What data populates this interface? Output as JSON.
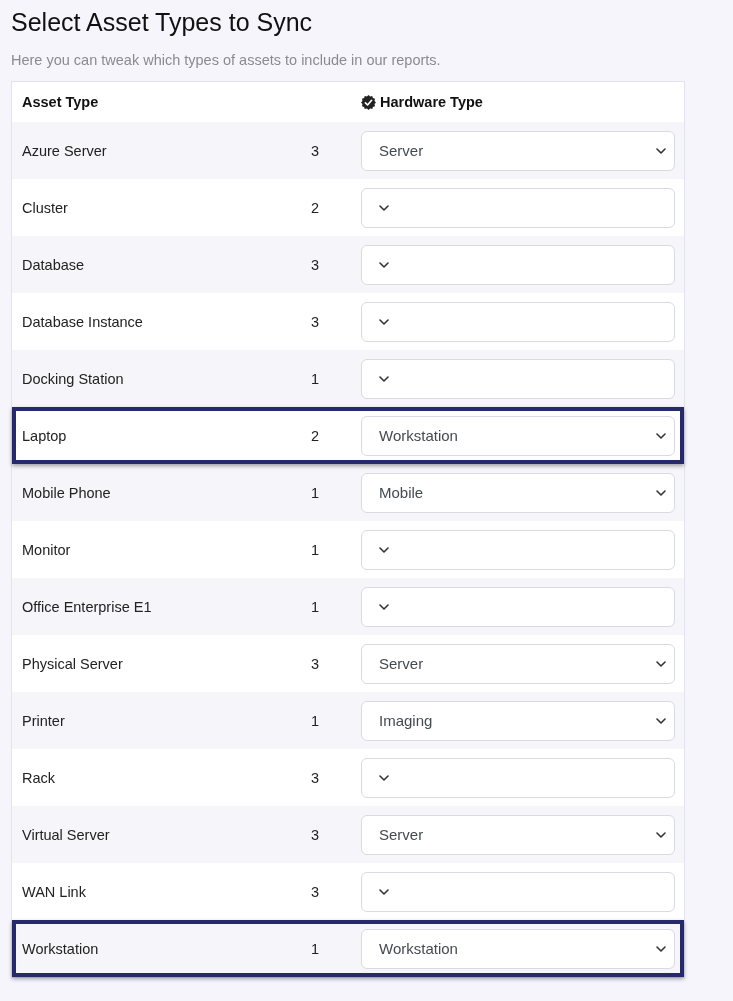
{
  "page": {
    "title": "Select Asset Types to Sync",
    "subtitle": "Here you can tweak which types of assets to include in our reports."
  },
  "table": {
    "columns": [
      "Asset Type",
      "Hardware Type"
    ],
    "rows": [
      {
        "asset_type": "Azure Server",
        "count": "3",
        "hardware_type": "Server",
        "highlighted": false
      },
      {
        "asset_type": "Cluster",
        "count": "2",
        "highlighted": false
      },
      {
        "asset_type": "Database",
        "count": "3",
        "highlighted": false
      },
      {
        "asset_type": "Database Instance",
        "count": "3",
        "highlighted": false
      },
      {
        "asset_type": "Docking Station",
        "count": "1",
        "highlighted": false
      },
      {
        "asset_type": "Laptop",
        "count": "2",
        "hardware_type": "Workstation",
        "highlighted": true
      },
      {
        "asset_type": "Mobile Phone",
        "count": "1",
        "hardware_type": "Mobile",
        "highlighted": false
      },
      {
        "asset_type": "Monitor",
        "count": "1",
        "highlighted": false
      },
      {
        "asset_type": "Office Enterprise E1",
        "count": "1",
        "highlighted": false
      },
      {
        "asset_type": "Physical Server",
        "count": "3",
        "hardware_type": "Server",
        "highlighted": false
      },
      {
        "asset_type": "Printer",
        "count": "1",
        "hardware_type": "Imaging",
        "highlighted": false
      },
      {
        "asset_type": "Rack",
        "count": "3",
        "highlighted": false
      },
      {
        "asset_type": "Virtual Server",
        "count": "3",
        "hardware_type": "Server",
        "highlighted": false
      },
      {
        "asset_type": "WAN Link",
        "count": "3",
        "highlighted": false
      },
      {
        "asset_type": "Workstation",
        "count": "1",
        "hardware_type": "Workstation",
        "highlighted": true
      }
    ]
  }
}
